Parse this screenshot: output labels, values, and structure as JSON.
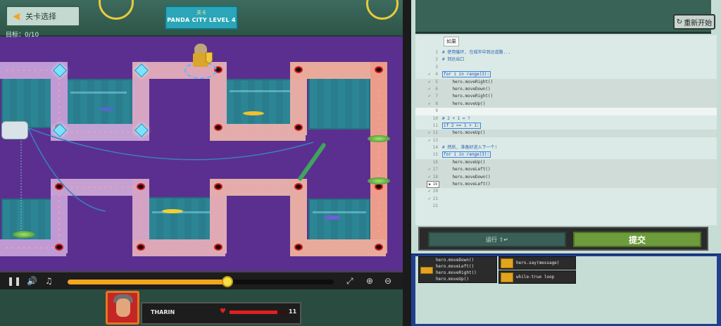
{
  "game": {
    "level_select_label": "关卡选择",
    "goal_label": "目标：",
    "goal_value": "0/10",
    "level_banner_sub": "关卡",
    "level_banner_title": "PANDA CITY LEVEL 4",
    "playback_progress": 0.6,
    "hero_name": "THARIN",
    "hero_health": "11",
    "hero_health_fraction": 0.85,
    "control_icons": [
      "pause-icon",
      "volume-icon",
      "music-icon",
      "fullscreen-icon",
      "zoom-in-icon",
      "zoom-out-icon"
    ]
  },
  "editor": {
    "restart_label": "重新开始",
    "tab_label": "如果",
    "lines": [
      {
        "n": "1",
        "text": "# 使用循环, 在城市中到达道路...",
        "type": "comment",
        "check": ""
      },
      {
        "n": "2",
        "text": "# 到达出口",
        "type": "comment",
        "check": ""
      },
      {
        "n": "3",
        "text": "",
        "type": "plain",
        "check": ""
      },
      {
        "n": "4",
        "text": "for i in range(3):",
        "type": "kw-box",
        "check": "✓"
      },
      {
        "n": "5",
        "text": "    hero.moveRight()",
        "type": "block",
        "check": "✓"
      },
      {
        "n": "6",
        "text": "    hero.moveDown()",
        "type": "block",
        "check": "✓"
      },
      {
        "n": "7",
        "text": "    hero.moveRight()",
        "type": "block",
        "check": "✓"
      },
      {
        "n": "8",
        "text": "    hero.moveUp()",
        "type": "block",
        "check": "✓"
      },
      {
        "n": "9",
        "text": "",
        "type": "cursor",
        "check": ""
      },
      {
        "n": "10",
        "text": "# 2 + 1 = ?",
        "type": "comment",
        "check": ""
      },
      {
        "n": "11",
        "text": "if 2 == 1 + 1:",
        "type": "kw-box",
        "check": ""
      },
      {
        "n": "12",
        "text": "    hero.moveUp()",
        "type": "block",
        "check": "✓"
      },
      {
        "n": "13",
        "text": "",
        "type": "plain",
        "check": "✓"
      },
      {
        "n": "14",
        "text": "# 然后, 准备好进入下一个!",
        "type": "comment",
        "check": ""
      },
      {
        "n": "15",
        "text": "for i in range(3):",
        "type": "kw-box",
        "check": ""
      },
      {
        "n": "16",
        "text": "    hero.moveUp()",
        "type": "block",
        "check": ""
      },
      {
        "n": "17",
        "text": "    hero.moveLeft()",
        "type": "block",
        "check": "✓"
      },
      {
        "n": "18",
        "text": "    hero.moveDown()",
        "type": "block",
        "check": "✓"
      },
      {
        "n": "19",
        "text": "    hero.moveLeft()",
        "type": "block-current",
        "check": ""
      },
      {
        "n": "20",
        "text": "",
        "type": "plain",
        "check": "✓"
      },
      {
        "n": "21",
        "text": "",
        "type": "plain",
        "check": "✓"
      },
      {
        "n": "22",
        "text": "",
        "type": "plain",
        "check": ""
      }
    ],
    "current_line_marker": "▶ 19",
    "run_label": "运行 ⇧↵",
    "submit_label": "提交"
  },
  "palette": {
    "move_snippets": [
      "hero.moveDown()",
      "hero.moveLeft()",
      "hero.moveRight()",
      "hero.moveUp()"
    ],
    "say_snippet": "hero.say(message)",
    "loop_snippet": "while-true loop"
  }
}
